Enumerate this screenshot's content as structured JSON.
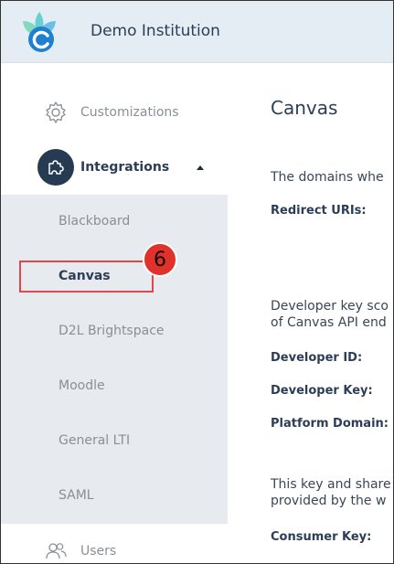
{
  "header": {
    "institution_name": "Demo Institution",
    "logo_icon": "logo-icon",
    "colors": {
      "background": "#e4edf3",
      "logo_primary": "#1f7fd1",
      "logo_secondary": "#3ec6c6"
    }
  },
  "sidebar": {
    "customizations": {
      "label": "Customizations",
      "icon": "gear-icon"
    },
    "integrations": {
      "label": "Integrations",
      "icon": "puzzle-icon",
      "expanded": true
    },
    "submenu": [
      {
        "label": "Blackboard"
      },
      {
        "label": "Canvas",
        "active": true
      },
      {
        "label": "D2L Brightspace"
      },
      {
        "label": "Moodle"
      },
      {
        "label": "General LTI"
      },
      {
        "label": "SAML"
      }
    ],
    "users": {
      "label": "Users",
      "icon": "users-icon"
    }
  },
  "annotation": {
    "step_number": "6",
    "color": "#e0312b"
  },
  "content": {
    "title": "Canvas",
    "para1": "The domains whe",
    "redirect_uris_label": "Redirect URIs:",
    "para2_line1": "Developer key sco",
    "para2_line2": "of Canvas API end",
    "developer_id_label": "Developer ID:",
    "developer_key_label": "Developer Key:",
    "platform_domain_label": "Platform Domain:",
    "para3_line1": "This key and share",
    "para3_line2": "provided by the w",
    "consumer_key_label": "Consumer Key:"
  }
}
